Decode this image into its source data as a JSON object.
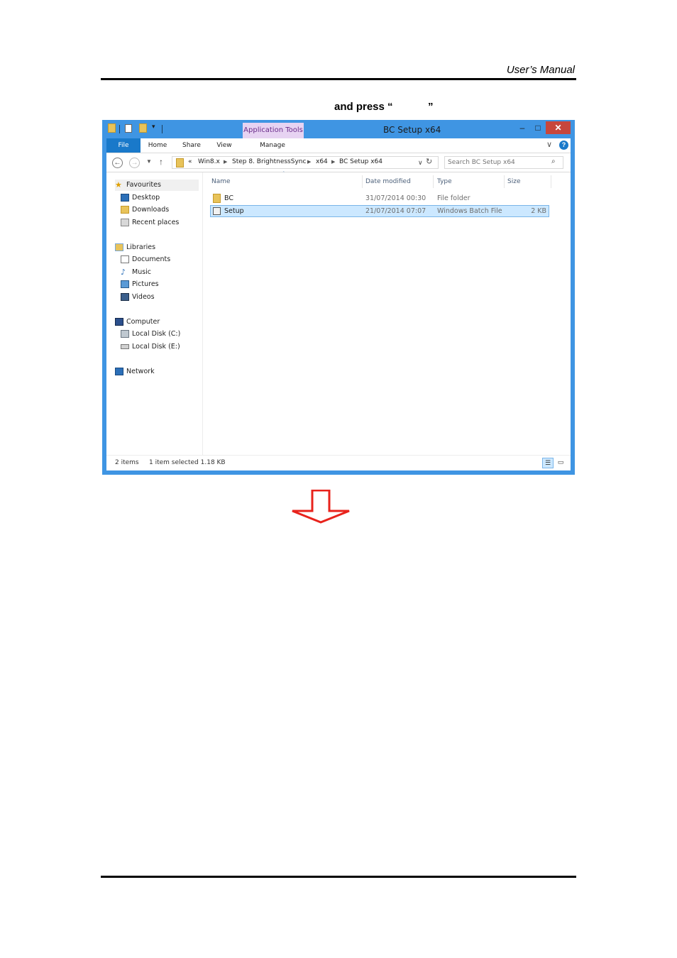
{
  "header": {
    "title": "User’s  Manual"
  },
  "instruction": {
    "part1": "and press “",
    "part2": "”"
  },
  "window": {
    "title": "BC Setup x64",
    "context_tab": "Application Tools",
    "controls": {
      "minimize": "–",
      "maximize": "□",
      "close": "✕"
    },
    "ribbon": {
      "tabs": [
        "File",
        "Home",
        "Share",
        "View",
        "Manage"
      ]
    },
    "address": {
      "overflow": "«",
      "breadcrumbs": [
        "Win8.x",
        "Step 8. BrightnessSync",
        "x64",
        "BC Setup x64"
      ]
    },
    "search": {
      "placeholder": "Search BC Setup x64"
    },
    "nav": {
      "favourites": {
        "label": "Favourites",
        "items": [
          "Desktop",
          "Downloads",
          "Recent places"
        ]
      },
      "libraries": {
        "label": "Libraries",
        "items": [
          "Documents",
          "Music",
          "Pictures",
          "Videos"
        ]
      },
      "computer": {
        "label": "Computer",
        "items": [
          "Local Disk (C:)",
          "Local Disk (E:)"
        ]
      },
      "network": {
        "label": "Network"
      }
    },
    "columns": [
      "Name",
      "Date modified",
      "Type",
      "Size"
    ],
    "files": [
      {
        "name": "BC",
        "date": "31/07/2014 00:30",
        "type": "File folder",
        "size": ""
      },
      {
        "name": "Setup",
        "date": "21/07/2014 07:07",
        "type": "Windows Batch File",
        "size": "2 KB"
      }
    ],
    "status": {
      "count": "2 items",
      "selection": "1 item selected  1.18 KB"
    }
  },
  "colors": {
    "accent": "#3f95e3",
    "selection": "#cce8ff",
    "arrow": "#e8231c",
    "close": "#c7463c"
  },
  "icons": [
    "folder-icon",
    "star-icon",
    "desktop-icon",
    "downloads-icon",
    "recent-places-icon",
    "libraries-icon",
    "documents-icon",
    "music-icon",
    "pictures-icon",
    "videos-icon",
    "computer-icon",
    "disk-icon",
    "network-icon",
    "batch-file-icon",
    "search-icon",
    "refresh-icon",
    "down-arrow-icon"
  ]
}
